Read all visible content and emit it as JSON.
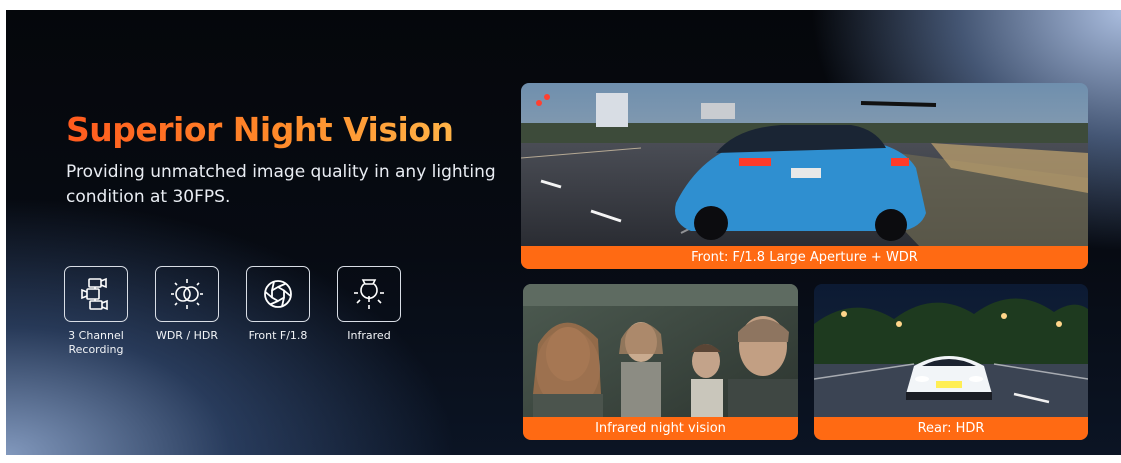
{
  "hero": {
    "headline": "Superior Night Vision",
    "subtitle": "Providing unmatched image quality in any lighting condition at 30FPS."
  },
  "features": [
    {
      "icon": "three-camera-icon",
      "label": "3 Channel Recording"
    },
    {
      "icon": "wdr-hdr-icon",
      "label": "WDR / HDR"
    },
    {
      "icon": "aperture-icon",
      "label": "Front F/1.8"
    },
    {
      "icon": "infrared-bulb-icon",
      "label": "Infrared"
    }
  ],
  "photos": {
    "front": {
      "caption": "Front:  F/1.8 Large Aperture + WDR"
    },
    "cabin": {
      "caption": "Infrared night vision"
    },
    "rear": {
      "caption": "Rear: HDR"
    }
  },
  "colors": {
    "accent_orange": "#ff6a13",
    "headline_gradient_start": "#ff5a1e",
    "headline_gradient_end": "#ffb347",
    "background_dark": "#05070b"
  }
}
